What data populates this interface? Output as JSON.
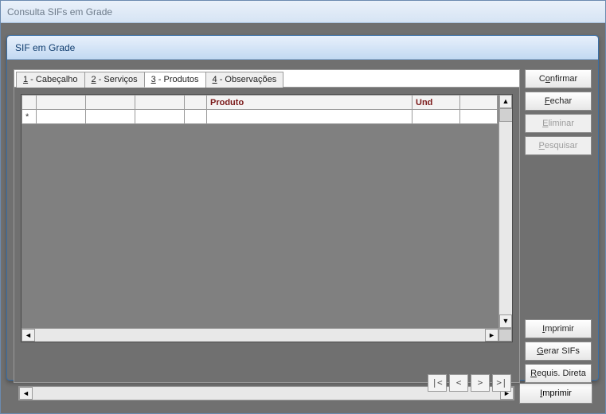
{
  "outer_window": {
    "title": "Consulta SIFs em Grade"
  },
  "dialog": {
    "title": "SIF em Grade",
    "tabs": [
      "1 - Cabeçalho",
      "2 - Serviços",
      "3 - Produtos",
      "4 - Observações"
    ],
    "active_tab_index": 2,
    "grid": {
      "columns": [
        "",
        "",
        "",
        "",
        "",
        "Produto",
        "Und",
        ""
      ],
      "new_row_marker": "*",
      "rows": []
    },
    "record_nav": {
      "first": "|<",
      "prev": "<",
      "next": ">",
      "last": ">|"
    }
  },
  "buttons": {
    "confirmar": "Confirmar",
    "fechar": "Fechar",
    "eliminar": "Eliminar",
    "pesquisar": "Pesquisar",
    "imprimir": "Imprimir",
    "gerar_sifs": "Gerar SIFs",
    "requis_direta": "Requis. Direta",
    "outer_imprimir": "Imprimir"
  }
}
